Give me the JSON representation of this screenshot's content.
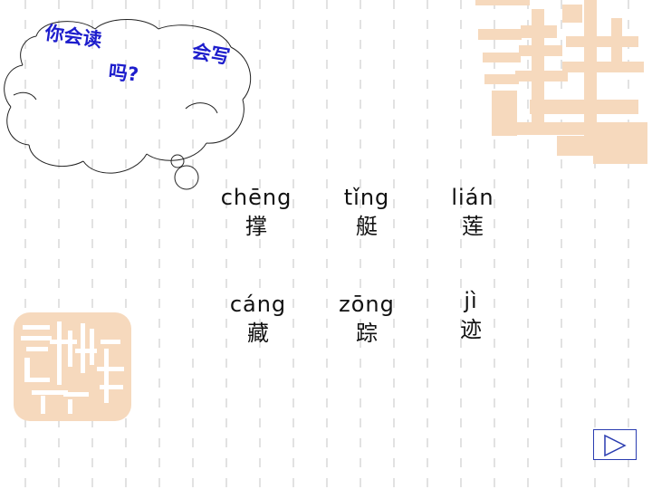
{
  "cloud": {
    "line1": "你会读",
    "line2": "吗?",
    "line3": "会写"
  },
  "words": [
    {
      "pinyin": "chēng",
      "hanzi": "撑"
    },
    {
      "pinyin": "tǐng",
      "hanzi": "艇"
    },
    {
      "pinyin": "lián",
      "hanzi": "莲"
    },
    {
      "pinyin": "cáng",
      "hanzi": "藏"
    },
    {
      "pinyin": "zōng",
      "hanzi": "踪"
    },
    {
      "pinyin": "jì",
      "hanzi": "迹"
    }
  ],
  "colors": {
    "cloud_text": "#1d1dcc",
    "seal": "#f6d9bd",
    "grid": "#e2e2e2",
    "button_border": "#2a3cb0"
  },
  "icons": {
    "next": "play-triangle-icon"
  }
}
